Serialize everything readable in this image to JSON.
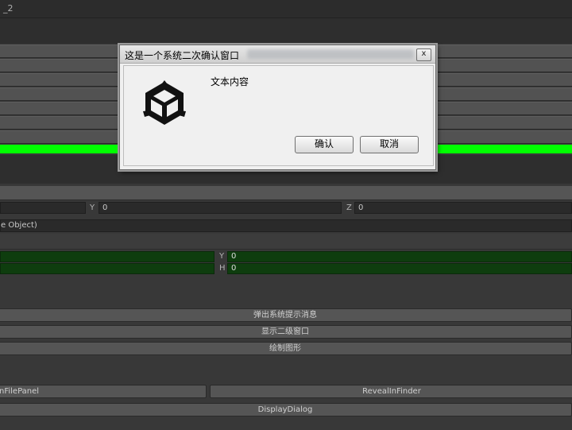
{
  "window": {
    "title": "_2"
  },
  "vector3_row": {
    "y_label": "Y",
    "y_value": "0",
    "z_label": "Z",
    "z_value": "0"
  },
  "object_field": {
    "text": "e Object)"
  },
  "rect_field": {
    "y_label": "Y",
    "y_value": "0",
    "h_label": "H",
    "h_value": "0"
  },
  "buttons": {
    "show_system_tip": "弹出系统提示消息",
    "show_second_window": "显示二级窗口",
    "draw_shape": "绘制图形",
    "open_file_panel": "nFilePanel",
    "reveal_in_finder": "RevealInFinder",
    "display_dialog": "DisplayDialog"
  },
  "dialog": {
    "title": "这是一个系统二次确认窗口",
    "close": "x",
    "message": "文本内容",
    "ok": "确认",
    "cancel": "取消",
    "icon": "unity-logo-icon"
  },
  "colors": {
    "green_bar": "#00ff00",
    "green_field": "#0e3d0e",
    "panel": "#383838"
  }
}
